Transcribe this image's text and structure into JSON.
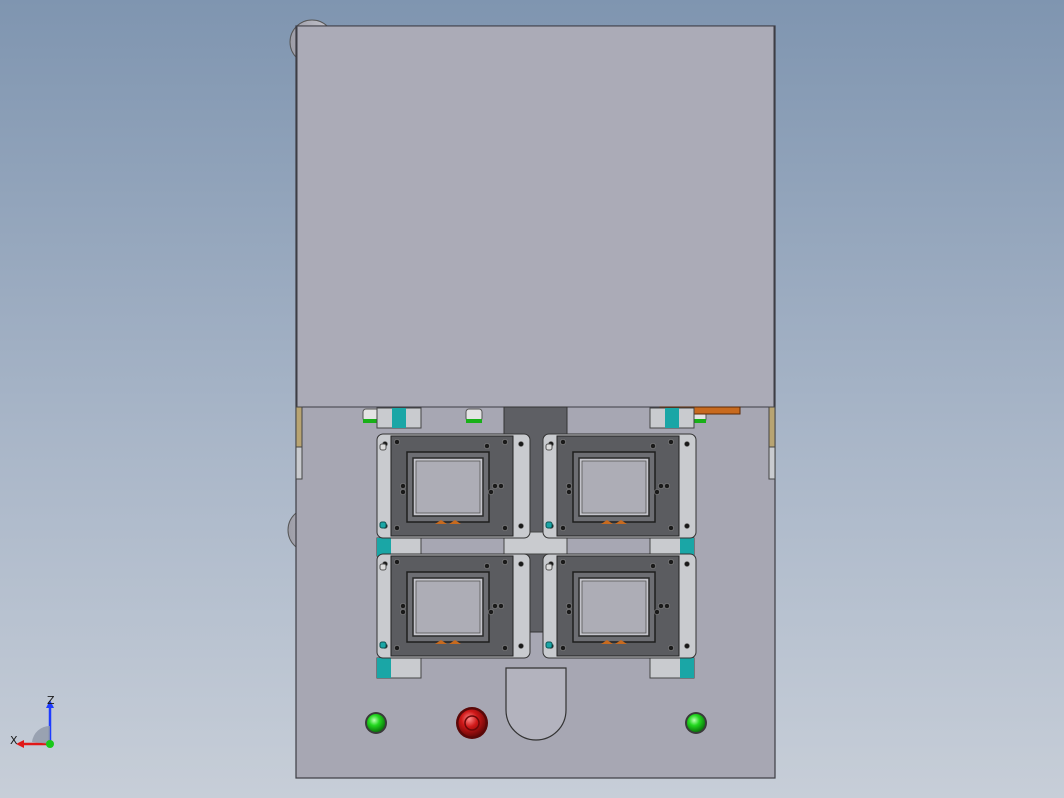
{
  "viewport": {
    "background_top": "#7f95b0",
    "background_bottom": "#c7ced8"
  },
  "model": {
    "plate_color": "#a9a9b5",
    "fixture_color": "#5b5c60",
    "frame_color": "#c9cbcf",
    "rail_color": "#1aa6a6",
    "button_start_color": "#1fd31f",
    "button_stop_color": "#c81818",
    "accent_orange": "#c86a1e",
    "nest_count": 4
  },
  "triad": {
    "z_label": "Z",
    "x_label": "X",
    "z_color": "#1e3cff",
    "x_color": "#e01818",
    "y_color": "#18c818"
  }
}
